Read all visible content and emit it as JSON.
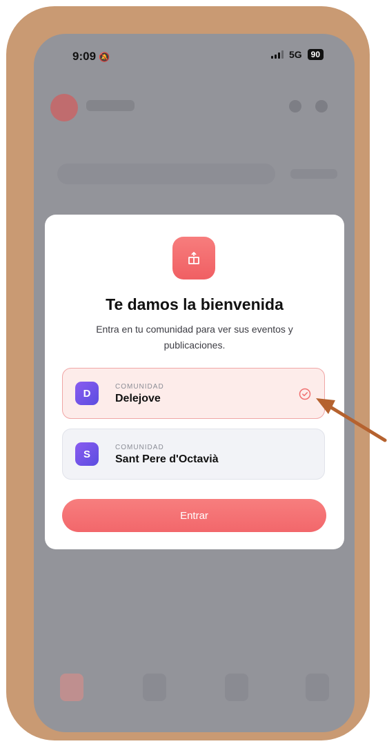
{
  "status_bar": {
    "time": "9:09",
    "network": "5G",
    "battery": "90"
  },
  "modal": {
    "title": "Te damos la bienvenida",
    "subtitle": "Entra en tu comunidad para ver sus eventos y publicaciones.",
    "communities": [
      {
        "kicker": "COMUNIDAD",
        "initial": "D",
        "name": "Delejove",
        "selected": true
      },
      {
        "kicker": "COMUNIDAD",
        "initial": "S",
        "name": "Sant Pere d'Octavià",
        "selected": false
      }
    ],
    "enter_label": "Entrar"
  },
  "colors": {
    "accent": "#f26b6e",
    "avatar": "#6e54e8",
    "frame": "#c99a73",
    "arrow": "#b5622f"
  },
  "icons": {
    "modal_icon": "community-building-icon",
    "selected_icon": "check-circle-icon",
    "mute_icon": "bell-slash-icon"
  }
}
